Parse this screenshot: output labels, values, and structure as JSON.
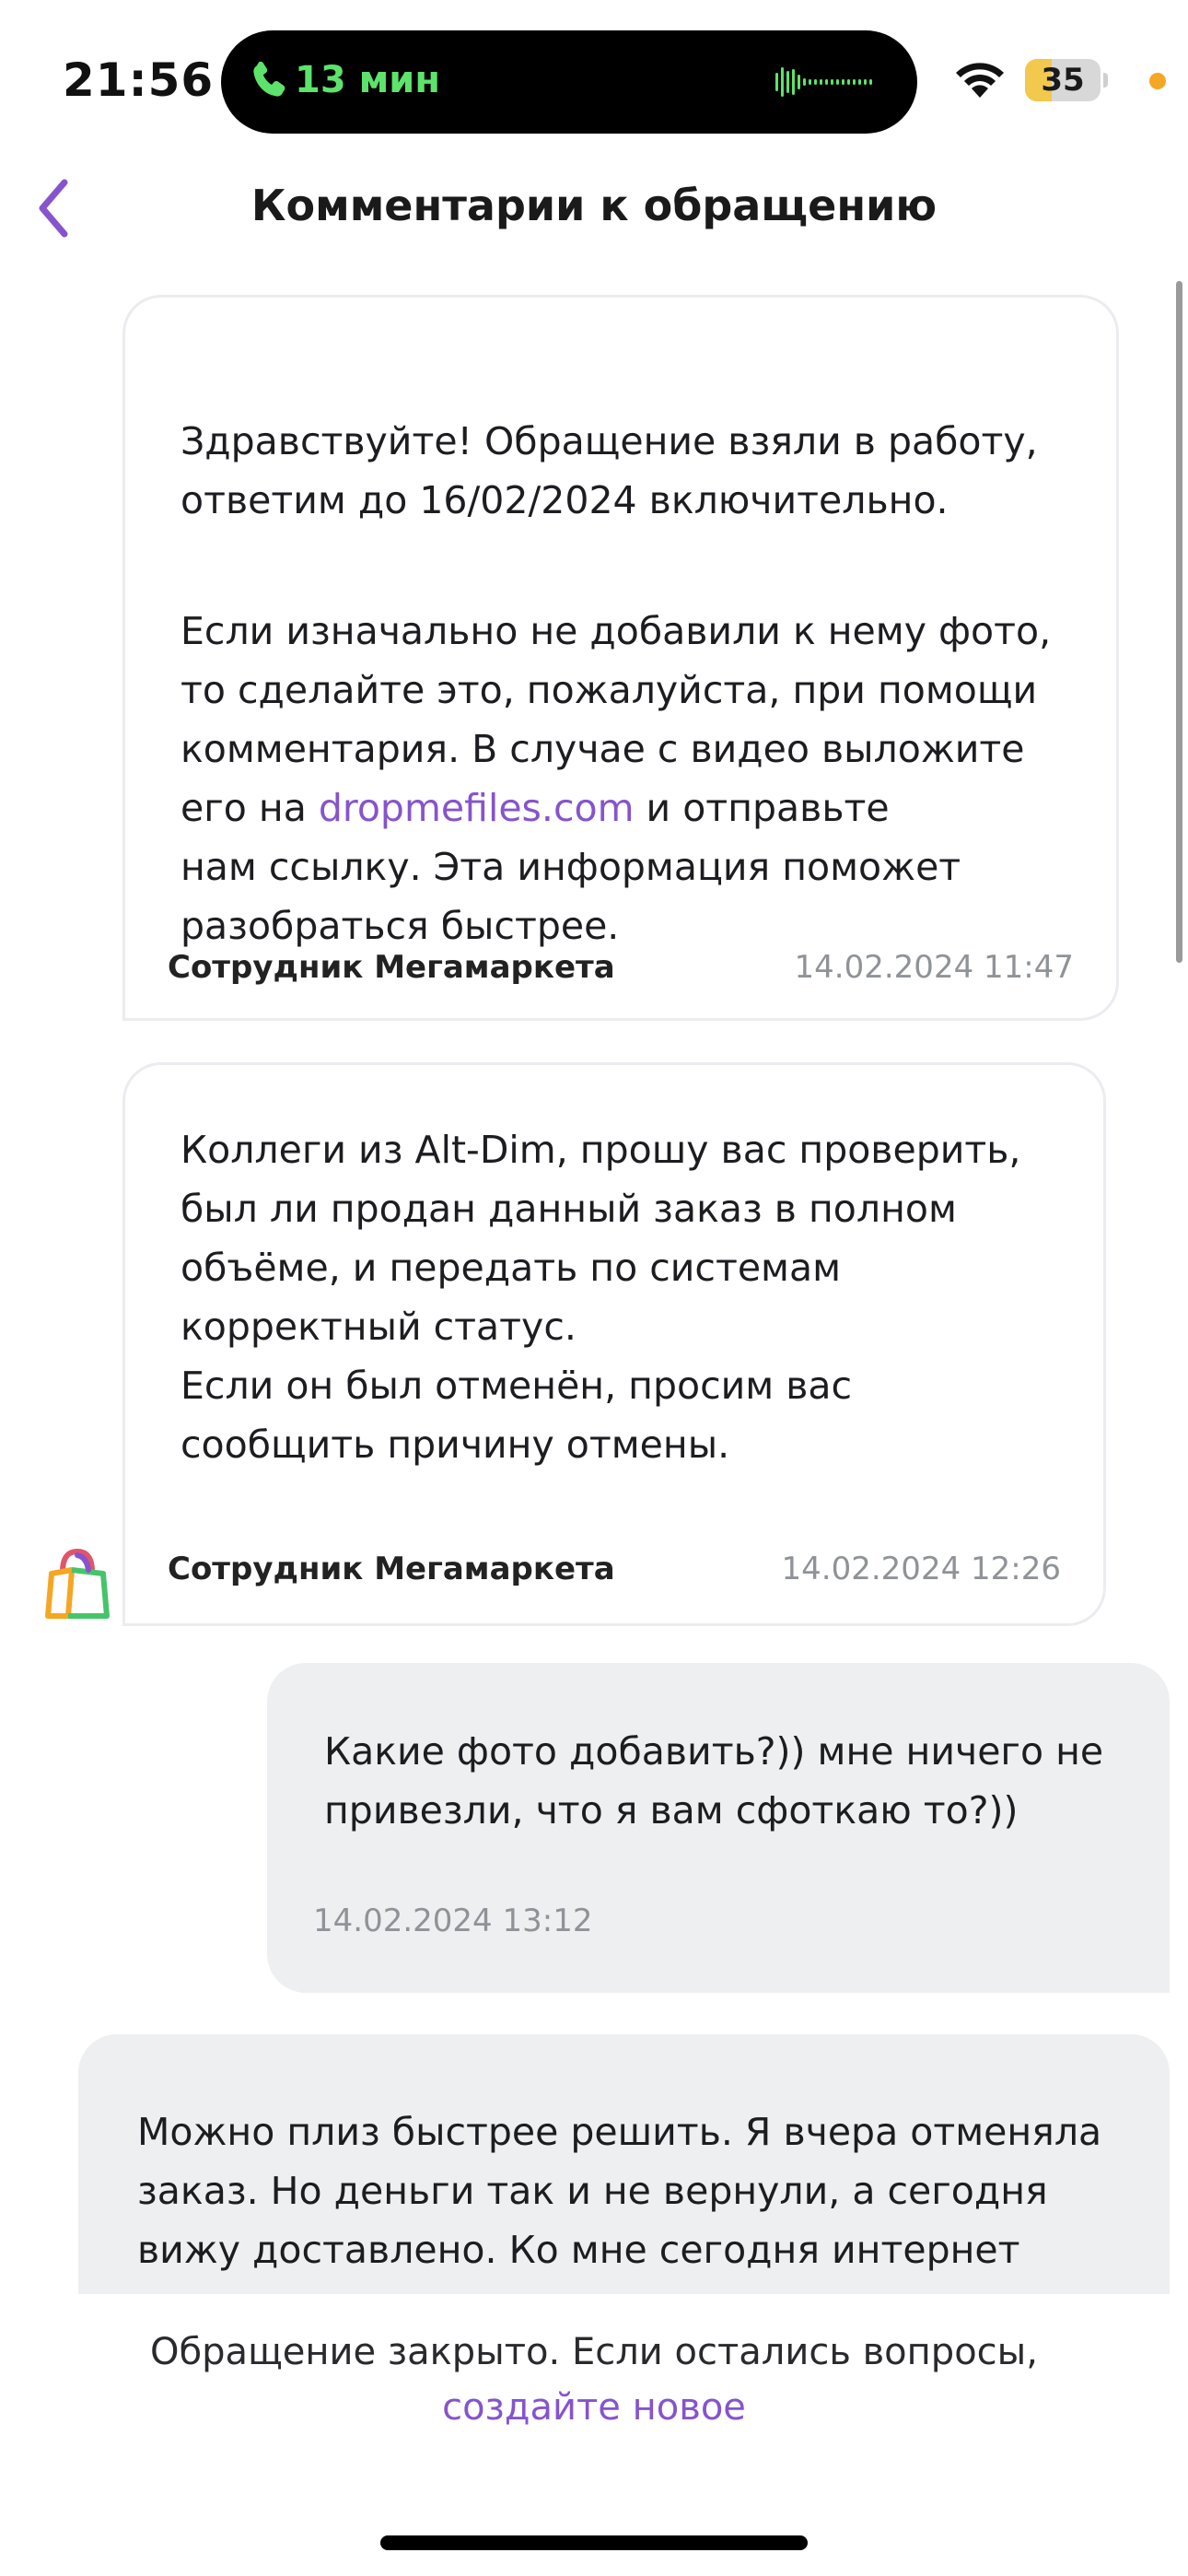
{
  "status_bar": {
    "time": "21:56",
    "call_duration": "13 мин",
    "battery_level": "35",
    "battery_fraction": 0.35,
    "colors": {
      "call_green": "#5de36b",
      "battery_yellow": "#f2c94c",
      "mic_orange": "#f5a623"
    }
  },
  "nav": {
    "back_icon": "chevron-left-icon",
    "title": "Комментарии к обращению"
  },
  "messages": [
    {
      "direction": "incoming",
      "paragraph1": "Здравствуйте! Обращение взяли в работу,\nответим до 16/02/2024 включительно.",
      "paragraph2_part1": "Если изначально не добавили к нему фото,\nто сделайте это, пожалуйста, при помощи\nкомментария. В случае с видео выложите\nего на ",
      "link_text": "dropmefiles.com",
      "paragraph2_part2": " и отправьте\nнам ссылку. Эта информация поможет\nразобраться быстрее.",
      "sender": "Сотрудник Мегамаркета",
      "timestamp": "14.02.2024 11:47"
    },
    {
      "direction": "incoming",
      "text": "Коллеги из Alt-Dim, прошу вас проверить,\nбыл ли продан данный заказ в полном\nобъёме, и передать по системам\nкорректный статус.\nЕсли он был отменён, просим вас\nсообщить причину отмены.",
      "sender": "Сотрудник Мегамаркета",
      "timestamp": "14.02.2024 12:26"
    },
    {
      "direction": "outgoing",
      "text": "Какие фото добавить?)) мне ничего не\nпривезли, что я вам сфоткаю то?))",
      "timestamp": "14.02.2024 13:12"
    },
    {
      "direction": "outgoing",
      "text": "Можно плиз быстрее решить. Я вчера отменяла\nзаказ. Но деньги так и не вернули, а сегодня\nвижу доставлено. Ко мне сегодня интернет\nприедут проводить, мне надо роутер закозать"
    }
  ],
  "avatar_icon": "megamarket-bag-icon",
  "footer": {
    "text": "Обращение закрыто. Если остались вопросы,",
    "link": "создайте новое"
  },
  "colors": {
    "accent": "#8654cc",
    "outgoing_bubble": "#eeeff1",
    "timestamp_gray": "#8f9398"
  }
}
